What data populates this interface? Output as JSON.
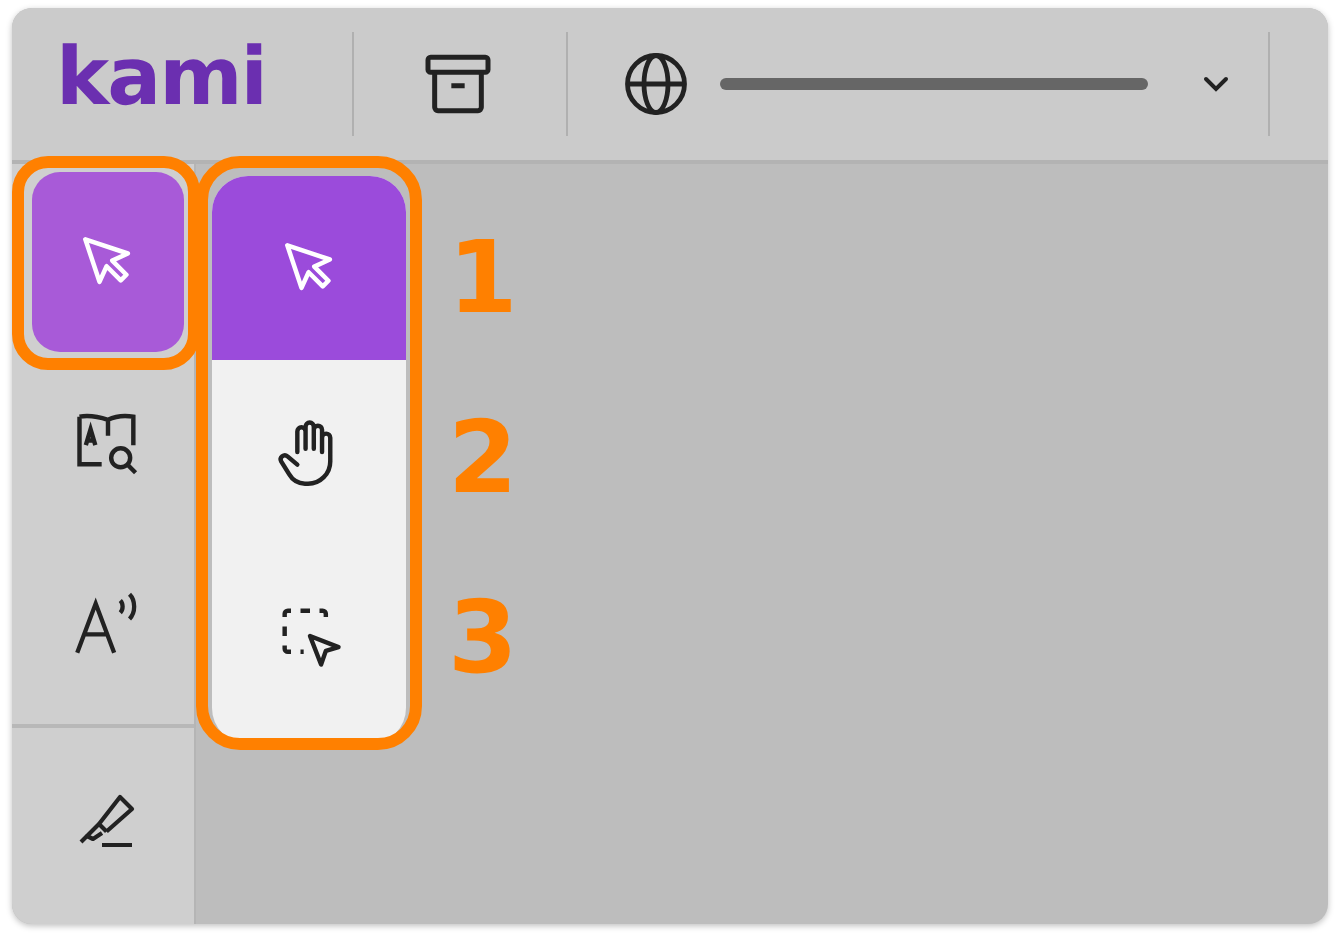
{
  "header": {
    "logo": "kami"
  },
  "sidebar": {
    "items": [
      {
        "kind": "select",
        "selected": true
      },
      {
        "kind": "dictionary",
        "selected": false
      },
      {
        "kind": "read-aloud",
        "selected": false
      },
      {
        "kind": "highlighter",
        "selected": false
      }
    ]
  },
  "flyout": {
    "items": [
      {
        "kind": "select",
        "selected": true
      },
      {
        "kind": "pan",
        "selected": false
      },
      {
        "kind": "area-select",
        "selected": false
      }
    ]
  },
  "annotations": {
    "labels": [
      "1",
      "2",
      "3"
    ]
  }
}
